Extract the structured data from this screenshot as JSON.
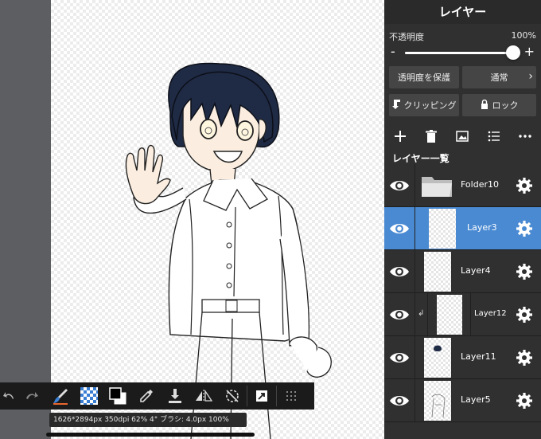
{
  "panel": {
    "title": "レイヤー",
    "opacity_label": "不透明度",
    "opacity_value": "100%",
    "opacity_fraction": 1.0,
    "minus": "-",
    "plus": "+",
    "protect_alpha_label": "透明度を保護",
    "blend_mode_label": "通常",
    "clipping_label": "クリッピング",
    "lock_label": "ロック",
    "layer_list_title": "レイヤー一覧"
  },
  "layers": [
    {
      "name": "Folder10",
      "type": "folder",
      "selected": false,
      "clipped": false
    },
    {
      "name": "Layer3",
      "type": "layer",
      "selected": true,
      "clipped": false
    },
    {
      "name": "Layer4",
      "type": "layer",
      "selected": false,
      "clipped": false
    },
    {
      "name": "Layer12",
      "type": "layer",
      "selected": false,
      "clipped": true
    },
    {
      "name": "Layer11",
      "type": "layer",
      "selected": false,
      "clipped": false
    },
    {
      "name": "Layer5",
      "type": "layer",
      "selected": false,
      "clipped": false
    }
  ],
  "status": {
    "text": "1626*2894px 350dpi 62% 4° ブラシ: 4.0px 100%"
  },
  "colors": {
    "selected_row": "#4a8ad2",
    "panel_bg": "#303030",
    "hair": "#1f2a44",
    "skin": "#fbeee0"
  },
  "icons": {
    "toolbar": [
      "add-layer-icon",
      "trash-icon",
      "import-image-icon",
      "list-icon",
      "more-icon"
    ],
    "bottom": [
      "undo-icon",
      "redo-icon",
      "brush-icon",
      "transparency-icon",
      "color-swatch-icon",
      "eyedropper-icon",
      "save-icon",
      "flip-icon",
      "rotate-reset-icon",
      "navigator-icon",
      "grid-menu-icon"
    ]
  }
}
